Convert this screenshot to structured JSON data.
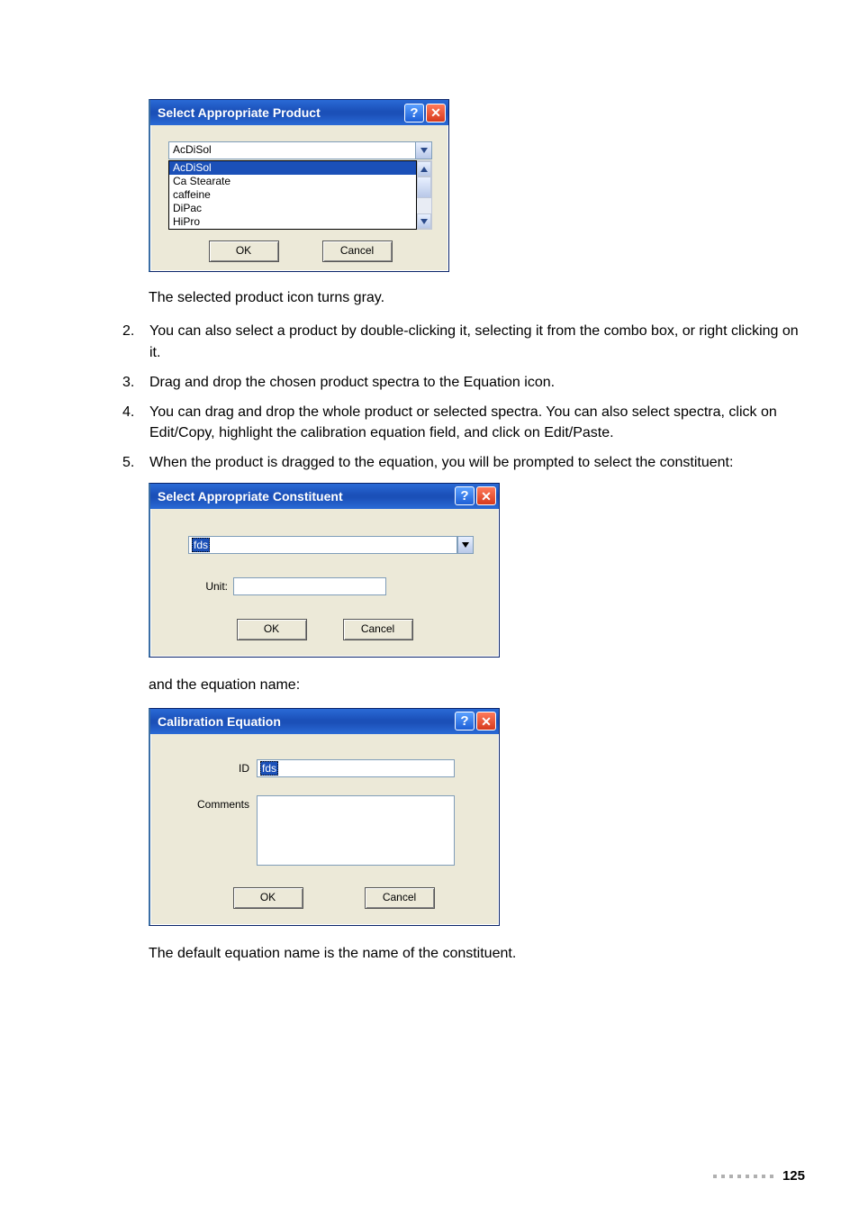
{
  "dialog1": {
    "title": "Select Appropriate Product",
    "help_tooltip": "Help",
    "close_tooltip": "Close",
    "selected_value": "AcDiSol",
    "options": [
      "AcDiSol",
      "Ca Stearate",
      "caffeine",
      "DiPac",
      "HiPro"
    ],
    "ok_label": "OK",
    "cancel_label": "Cancel"
  },
  "afterDlg1Text": "The selected product icon turns gray.",
  "steps": [
    {
      "num": "2.",
      "text": "You can also select a product by double-clicking it, selecting it from the combo box, or right clicking on it."
    },
    {
      "num": "3.",
      "text": "Drag and drop the chosen product spectra to the Equation icon."
    },
    {
      "num": "4.",
      "text": "You can drag and drop the whole product or selected spectra. You can also select spectra, click on Edit/Copy, highlight the calibration equation field, and click on Edit/Paste."
    },
    {
      "num": "5.",
      "text": "When the product is dragged to the equation, you will be prompted to select the constituent:"
    }
  ],
  "dialog2": {
    "title": "Select Appropriate Constituent",
    "combo_value": "fds",
    "unit_label": "Unit:",
    "unit_value": "",
    "ok_label": "OK",
    "cancel_label": "Cancel"
  },
  "afterDlg2Text": "and the equation name:",
  "dialog3": {
    "title": "Calibration Equation",
    "id_label": "ID",
    "id_value": "fds",
    "comments_label": "Comments",
    "comments_value": "",
    "ok_label": "OK",
    "cancel_label": "Cancel"
  },
  "afterDlg3Text": "The default equation name is the name of the constituent.",
  "page_number": "125"
}
